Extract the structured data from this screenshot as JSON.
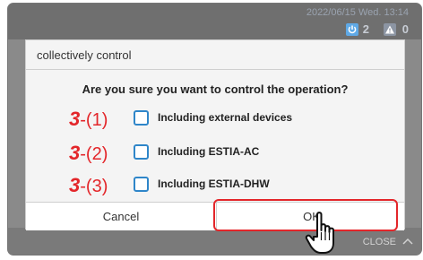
{
  "status_bar": {
    "datetime": "2022/06/15 Wed. 13:14",
    "power_count": "2",
    "alert_count": "0",
    "power_icon": "power-icon",
    "alert_icon": "warning-icon"
  },
  "dialog": {
    "title": "collectively control",
    "question": "Are you sure you want to control the operation?",
    "options": [
      {
        "number": "3",
        "sub": "-(1)",
        "label": "Including external devices",
        "checked": false
      },
      {
        "number": "3",
        "sub": "-(2)",
        "label": "Including ESTIA-AC",
        "checked": false
      },
      {
        "number": "3",
        "sub": "-(3)",
        "label": "Including ESTIA-DHW",
        "checked": false
      }
    ],
    "cancel_label": "Cancel",
    "ok_label": "OK"
  },
  "footer": {
    "close_label": "CLOSE"
  },
  "colors": {
    "accent_red": "#e3262a",
    "checkbox_blue": "#2f86c9"
  }
}
